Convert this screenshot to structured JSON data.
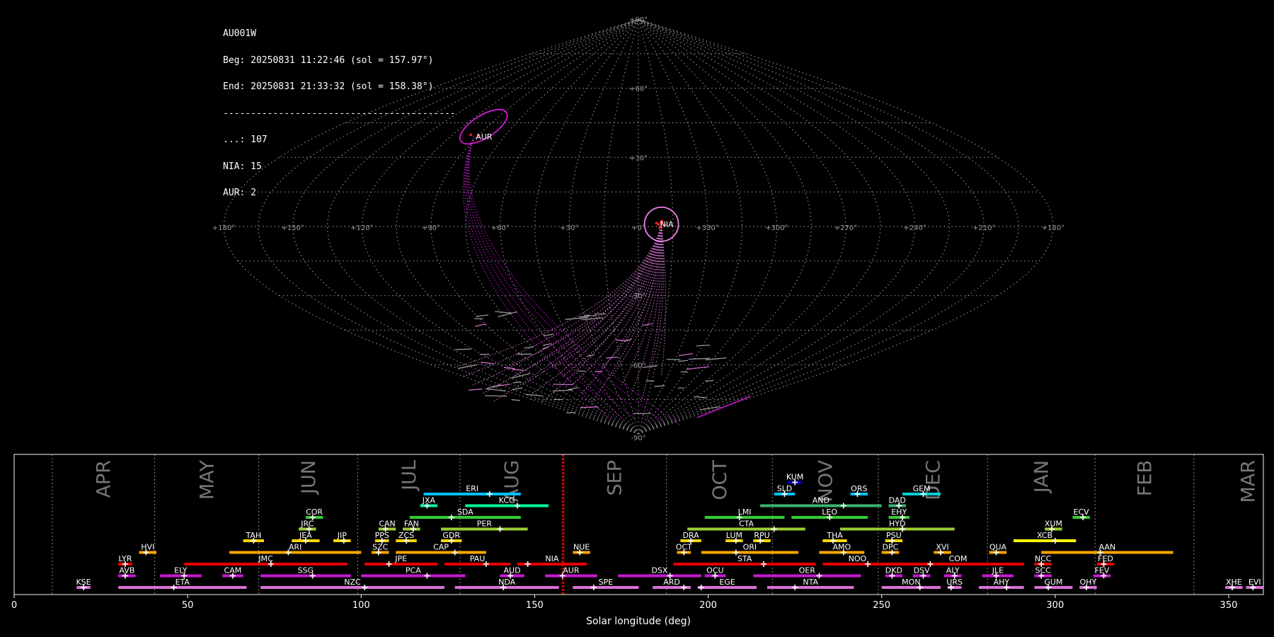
{
  "summary": {
    "station": "AU001W",
    "begin": "Beg: 20250831 11:22:46 (sol = 157.97°)",
    "end": "End: 20250831 21:33:32 (sol = 158.38°)",
    "separator": "------------------------------------------",
    "counts": [
      {
        "label": "...: 107"
      },
      {
        "label": "NIA: 15"
      },
      {
        "label": "AUR: 2"
      }
    ]
  },
  "sky_map": {
    "projection": "sinusoidal",
    "lon_labels": [
      "+180°",
      "+150°",
      "+120°",
      "+90°",
      "+60°",
      "+30°",
      "+0°",
      "+330°",
      "+300°",
      "+270°",
      "+240°",
      "+210°",
      "+180°"
    ],
    "lat_labels": [
      "+90°",
      "+60°",
      "+30°",
      "-30°",
      "-60°",
      "-90°"
    ],
    "radiants": [
      {
        "code": "AUR",
        "ra": 92,
        "dec": 39,
        "color": "#d21ad2"
      },
      {
        "code": "NIA",
        "ra": 350,
        "dec": 1,
        "color": "#ee82ee"
      }
    ]
  },
  "chart_data": {
    "type": "timeline",
    "xlabel": "Solar longitude (deg)",
    "xlim": [
      0,
      360
    ],
    "xticks": [
      0,
      50,
      100,
      150,
      200,
      250,
      300,
      350
    ],
    "current_sol": [
      157.97,
      158.38
    ],
    "months": [
      {
        "name": "APR",
        "start": 11
      },
      {
        "name": "MAY",
        "start": 40.5
      },
      {
        "name": "JUN",
        "start": 70.5
      },
      {
        "name": "JUL",
        "start": 99
      },
      {
        "name": "AUG",
        "start": 128.5
      },
      {
        "name": "SEP",
        "start": 158
      },
      {
        "name": "OCT",
        "start": 188
      },
      {
        "name": "NOV",
        "start": 218.5
      },
      {
        "name": "DEC",
        "start": 249
      },
      {
        "name": "JAN",
        "start": 280.5
      },
      {
        "name": "FEB",
        "start": 311.5
      },
      {
        "name": "MAR",
        "start": 340
      }
    ],
    "showers": [
      {
        "code": "KUM",
        "start": 223,
        "end": 227,
        "peak": 225,
        "row": 10,
        "color": "#0000cd"
      },
      {
        "code": "ERI",
        "start": 118,
        "end": 146,
        "peak": 137,
        "row": 9,
        "color": "#00bfff"
      },
      {
        "code": "SLD",
        "start": 219,
        "end": 225,
        "peak": 222,
        "row": 9,
        "color": "#00bfff"
      },
      {
        "code": "ORS",
        "start": 241,
        "end": 246,
        "peak": 243,
        "row": 9,
        "color": "#00bfff"
      },
      {
        "code": "GEM",
        "start": 256,
        "end": 267,
        "peak": 262,
        "row": 9,
        "color": "#00ced1"
      },
      {
        "code": "JXA",
        "start": 117,
        "end": 122,
        "peak": 119,
        "row": 8,
        "color": "#00fa9a"
      },
      {
        "code": "KCG",
        "start": 130,
        "end": 154,
        "peak": 145,
        "row": 8,
        "color": "#00fa9a"
      },
      {
        "code": "AND",
        "start": 215,
        "end": 250,
        "peak": 239,
        "row": 8,
        "color": "#3cb371"
      },
      {
        "code": "DAD",
        "start": 252,
        "end": 257,
        "peak": 255,
        "row": 8,
        "color": "#3cb371"
      },
      {
        "code": "COR",
        "start": 84,
        "end": 89,
        "peak": 86,
        "row": 7,
        "color": "#32cd32"
      },
      {
        "code": "SDA",
        "start": 114,
        "end": 146,
        "peak": 126,
        "row": 7,
        "color": "#32cd32"
      },
      {
        "code": "LMI",
        "start": 199,
        "end": 222,
        "peak": 209,
        "row": 7,
        "color": "#32cd32"
      },
      {
        "code": "LEO",
        "start": 224,
        "end": 246,
        "peak": 235,
        "row": 7,
        "color": "#32cd32"
      },
      {
        "code": "EHY",
        "start": 252,
        "end": 258,
        "peak": 256,
        "row": 7,
        "color": "#32cd32"
      },
      {
        "code": "ECV",
        "start": 305,
        "end": 310,
        "peak": 308,
        "row": 7,
        "color": "#32cd32"
      },
      {
        "code": "JRC",
        "start": 82,
        "end": 87,
        "peak": 85,
        "row": 6,
        "color": "#9acd32"
      },
      {
        "code": "CAN",
        "start": 105,
        "end": 110,
        "peak": 107,
        "row": 6,
        "color": "#9acd32"
      },
      {
        "code": "FAN",
        "start": 112,
        "end": 117,
        "peak": 115,
        "row": 6,
        "color": "#9acd32"
      },
      {
        "code": "PER",
        "start": 123,
        "end": 148,
        "peak": 140,
        "row": 6,
        "color": "#9acd32"
      },
      {
        "code": "CTA",
        "start": 194,
        "end": 228,
        "peak": 219,
        "row": 6,
        "color": "#9acd32"
      },
      {
        "code": "HYD",
        "start": 238,
        "end": 271,
        "peak": 256,
        "row": 6,
        "color": "#9acd32"
      },
      {
        "code": "XUM",
        "start": 297,
        "end": 302,
        "peak": 299,
        "row": 6,
        "color": "#9acd32"
      },
      {
        "code": "TAH",
        "start": 66,
        "end": 72,
        "peak": 69,
        "row": 5,
        "color": "#ffd700"
      },
      {
        "code": "JEA",
        "start": 80,
        "end": 88,
        "peak": 84,
        "row": 5,
        "color": "#ffd700"
      },
      {
        "code": "JIP",
        "start": 92,
        "end": 97,
        "peak": 95,
        "row": 5,
        "color": "#ffd700"
      },
      {
        "code": "PPS",
        "start": 104,
        "end": 108,
        "peak": 106,
        "row": 5,
        "color": "#ffd700"
      },
      {
        "code": "ZCS",
        "start": 110,
        "end": 116,
        "peak": 113,
        "row": 5,
        "color": "#ffd700"
      },
      {
        "code": "GDR",
        "start": 123,
        "end": 129,
        "peak": 126,
        "row": 5,
        "color": "#ffd700"
      },
      {
        "code": "DRA",
        "start": 192,
        "end": 198,
        "peak": 195,
        "row": 5,
        "color": "#ffd700"
      },
      {
        "code": "LUM",
        "start": 205,
        "end": 210,
        "peak": 208,
        "row": 5,
        "color": "#ffd700"
      },
      {
        "code": "RPU",
        "start": 213,
        "end": 218,
        "peak": 215,
        "row": 5,
        "color": "#ffd700"
      },
      {
        "code": "THA",
        "start": 233,
        "end": 240,
        "peak": 236,
        "row": 5,
        "color": "#ffd700"
      },
      {
        "code": "PSU",
        "start": 251,
        "end": 256,
        "peak": 253,
        "row": 5,
        "color": "#ffd700"
      },
      {
        "code": "XCB",
        "start": 288,
        "end": 306,
        "peak": 300,
        "row": 5,
        "color": "#ffff00"
      },
      {
        "code": "HVI",
        "start": 36,
        "end": 41,
        "peak": 38,
        "row": 4,
        "color": "#ffa500"
      },
      {
        "code": "ARI",
        "start": 62,
        "end": 100,
        "peak": 79,
        "row": 4,
        "color": "#ffa500"
      },
      {
        "code": "SZC",
        "start": 103,
        "end": 108,
        "peak": 105,
        "row": 4,
        "color": "#ffa500"
      },
      {
        "code": "CAP",
        "start": 110,
        "end": 136,
        "peak": 127,
        "row": 4,
        "color": "#ffa500"
      },
      {
        "code": "NUE",
        "start": 161,
        "end": 166,
        "peak": 163,
        "row": 4,
        "color": "#ffa500"
      },
      {
        "code": "OCT",
        "start": 191,
        "end": 195,
        "peak": 193,
        "row": 4,
        "color": "#ffa500"
      },
      {
        "code": "ORI",
        "start": 198,
        "end": 226,
        "peak": 208,
        "row": 4,
        "color": "#ffa500"
      },
      {
        "code": "AMO",
        "start": 232,
        "end": 245,
        "peak": 239,
        "row": 4,
        "color": "#ffa500"
      },
      {
        "code": "DPC",
        "start": 250,
        "end": 255,
        "peak": 253,
        "row": 4,
        "color": "#ffa500"
      },
      {
        "code": "XVI",
        "start": 265,
        "end": 270,
        "peak": 267,
        "row": 4,
        "color": "#ffa500"
      },
      {
        "code": "QUA",
        "start": 281,
        "end": 286,
        "peak": 283,
        "row": 4,
        "color": "#ffa500"
      },
      {
        "code": "AAN",
        "start": 296,
        "end": 334,
        "peak": 313,
        "row": 4,
        "color": "#ffa500"
      },
      {
        "code": "LYR",
        "start": 30,
        "end": 34,
        "peak": 32,
        "row": 3,
        "color": "#ff0000"
      },
      {
        "code": "JMC",
        "start": 49,
        "end": 96,
        "peak": 74,
        "row": 3,
        "color": "#e60000"
      },
      {
        "code": "JPE",
        "start": 101,
        "end": 122,
        "peak": 108,
        "row": 3,
        "color": "#e60000"
      },
      {
        "code": "PAU",
        "start": 124,
        "end": 143,
        "peak": 136,
        "row": 3,
        "color": "#e60000"
      },
      {
        "code": "NIA",
        "start": 145,
        "end": 165,
        "peak": 148,
        "row": 3,
        "color": "#e60000"
      },
      {
        "code": "STA",
        "start": 190,
        "end": 231,
        "peak": 216,
        "row": 3,
        "color": "#e60000"
      },
      {
        "code": "NOO",
        "start": 233,
        "end": 253,
        "peak": 246,
        "row": 3,
        "color": "#e60000"
      },
      {
        "code": "COM",
        "start": 253,
        "end": 291,
        "peak": 264,
        "row": 3,
        "color": "#e60000"
      },
      {
        "code": "NCC",
        "start": 294,
        "end": 299,
        "peak": 296,
        "row": 3,
        "color": "#e60000"
      },
      {
        "code": "FED",
        "start": 312,
        "end": 317,
        "peak": 314,
        "row": 3,
        "color": "#e60000"
      },
      {
        "code": "AVB",
        "start": 30,
        "end": 35,
        "peak": 32,
        "row": 2,
        "color": "#c71ad2"
      },
      {
        "code": "ELY",
        "start": 42,
        "end": 54,
        "peak": 49,
        "row": 2,
        "color": "#c71ad2"
      },
      {
        "code": "CAM",
        "start": 60,
        "end": 66,
        "peak": 63,
        "row": 2,
        "color": "#c71ad2"
      },
      {
        "code": "SSG",
        "start": 71,
        "end": 97,
        "peak": 86,
        "row": 2,
        "color": "#c71ad2"
      },
      {
        "code": "PCA",
        "start": 100,
        "end": 130,
        "peak": 119,
        "row": 2,
        "color": "#c71ad2"
      },
      {
        "code": "AUD",
        "start": 140,
        "end": 147,
        "peak": 143,
        "row": 2,
        "color": "#c71ad2"
      },
      {
        "code": "AUR",
        "start": 153,
        "end": 168,
        "peak": 158,
        "row": 2,
        "color": "#c71ad2"
      },
      {
        "code": "DSX",
        "start": 174,
        "end": 198,
        "peak": 189,
        "row": 2,
        "color": "#c71ad2"
      },
      {
        "code": "OCU",
        "start": 199,
        "end": 205,
        "peak": 202,
        "row": 2,
        "color": "#c71ad2"
      },
      {
        "code": "OER",
        "start": 213,
        "end": 244,
        "peak": 232,
        "row": 2,
        "color": "#c71ad2"
      },
      {
        "code": "DKD",
        "start": 251,
        "end": 256,
        "peak": 253,
        "row": 2,
        "color": "#c71ad2"
      },
      {
        "code": "DSV",
        "start": 259,
        "end": 264,
        "peak": 262,
        "row": 2,
        "color": "#c71ad2"
      },
      {
        "code": "ALY",
        "start": 268,
        "end": 273,
        "peak": 271,
        "row": 2,
        "color": "#c71ad2"
      },
      {
        "code": "JLE",
        "start": 279,
        "end": 288,
        "peak": 283,
        "row": 2,
        "color": "#c71ad2"
      },
      {
        "code": "SCC",
        "start": 294,
        "end": 299,
        "peak": 296,
        "row": 2,
        "color": "#c71ad2"
      },
      {
        "code": "FEV",
        "start": 311,
        "end": 316,
        "peak": 314,
        "row": 2,
        "color": "#c71ad2"
      },
      {
        "code": "KSE",
        "start": 18,
        "end": 22,
        "peak": 20,
        "row": 1,
        "color": "#da70d6"
      },
      {
        "code": "ETA",
        "start": 30,
        "end": 67,
        "peak": 46,
        "row": 1,
        "color": "#da70d6"
      },
      {
        "code": "NZC",
        "start": 71,
        "end": 124,
        "peak": 101,
        "row": 1,
        "color": "#da70d6"
      },
      {
        "code": "NDA",
        "start": 127,
        "end": 157,
        "peak": 141,
        "row": 1,
        "color": "#da70d6"
      },
      {
        "code": "SPE",
        "start": 161,
        "end": 180,
        "peak": 167,
        "row": 1,
        "color": "#da70d6"
      },
      {
        "code": "ARD",
        "start": 184,
        "end": 195,
        "peak": 193,
        "row": 1,
        "color": "#da70d6"
      },
      {
        "code": "EGE",
        "start": 197,
        "end": 214,
        "peak": 198,
        "row": 1,
        "color": "#da70d6"
      },
      {
        "code": "NTA",
        "start": 217,
        "end": 242,
        "peak": 225,
        "row": 1,
        "color": "#da70d6"
      },
      {
        "code": "MON",
        "start": 250,
        "end": 267,
        "peak": 261,
        "row": 1,
        "color": "#da70d6"
      },
      {
        "code": "URS",
        "start": 269,
        "end": 273,
        "peak": 270,
        "row": 1,
        "color": "#da70d6"
      },
      {
        "code": "AHY",
        "start": 278,
        "end": 291,
        "peak": 286,
        "row": 1,
        "color": "#da70d6"
      },
      {
        "code": "GUM",
        "start": 294,
        "end": 305,
        "peak": 298,
        "row": 1,
        "color": "#da70d6"
      },
      {
        "code": "OHY",
        "start": 307,
        "end": 312,
        "peak": 309,
        "row": 1,
        "color": "#da70d6"
      },
      {
        "code": "XHE",
        "start": 349,
        "end": 354,
        "peak": 351,
        "row": 1,
        "color": "#da70d6"
      },
      {
        "code": "EVI",
        "start": 355,
        "end": 360,
        "peak": 357,
        "row": 1,
        "color": "#da70d6"
      }
    ]
  }
}
